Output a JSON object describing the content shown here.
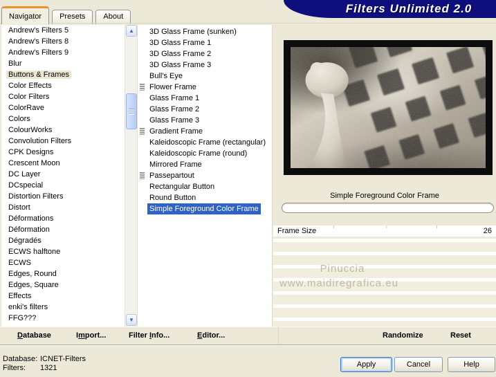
{
  "banner": {
    "title": "Filters Unlimited 2.0"
  },
  "icons": {
    "scroll_up_icon": "▲",
    "scroll_down_icon": "▼"
  },
  "tabs": [
    {
      "label": "Navigator",
      "active": true
    },
    {
      "label": "Presets"
    },
    {
      "label": "About"
    }
  ],
  "categories": [
    {
      "label": "Andrew's Filters 5"
    },
    {
      "label": "Andrew's Filters 8"
    },
    {
      "label": "Andrew's Filters 9"
    },
    {
      "label": "Blur"
    },
    {
      "label": "Buttons & Frames",
      "highlight": true
    },
    {
      "label": "Color Effects"
    },
    {
      "label": "Color Filters"
    },
    {
      "label": "ColorRave"
    },
    {
      "label": "Colors"
    },
    {
      "label": "ColourWorks"
    },
    {
      "label": "Convolution Filters"
    },
    {
      "label": "CPK Designs"
    },
    {
      "label": "Crescent Moon"
    },
    {
      "label": "DC Layer"
    },
    {
      "label": "DCspecial"
    },
    {
      "label": "Distortion Filters"
    },
    {
      "label": "Distort"
    },
    {
      "label": "Déformations"
    },
    {
      "label": "Déformation"
    },
    {
      "label": "Dégradés"
    },
    {
      "label": "ECWS halftone"
    },
    {
      "label": "ECWS"
    },
    {
      "label": "Edges, Round"
    },
    {
      "label": "Edges, Square"
    },
    {
      "label": "Effects"
    },
    {
      "label": "enki's filters"
    },
    {
      "label": "FFG???"
    }
  ],
  "filters": [
    {
      "label": "3D Glass Frame (sunken)"
    },
    {
      "label": "3D Glass Frame 1"
    },
    {
      "label": "3D Glass Frame 2"
    },
    {
      "label": "3D Glass Frame 3"
    },
    {
      "label": "Bull's Eye"
    },
    {
      "label": "Flower Frame",
      "marked": true
    },
    {
      "label": "Glass Frame 1"
    },
    {
      "label": "Glass Frame 2"
    },
    {
      "label": "Glass Frame 3"
    },
    {
      "label": "Gradient Frame",
      "marked": true
    },
    {
      "label": "Kaleidoscopic Frame (rectangular)"
    },
    {
      "label": "Kaleidoscopic Frame (round)"
    },
    {
      "label": "Mirrored Frame"
    },
    {
      "label": "Passepartout",
      "marked": true
    },
    {
      "label": "Rectangular Button"
    },
    {
      "label": "Round Button"
    },
    {
      "label": "Simple Foreground Color Frame",
      "selected": true
    }
  ],
  "controls": {
    "selected_filter_label": "Simple Foreground Color Frame",
    "frame_size": {
      "name": "Frame Size",
      "value": "26"
    }
  },
  "watermark": {
    "line1": "Pinuccia",
    "line2": "www.maidiregrafica.eu"
  },
  "menu": {
    "database": {
      "label": "Database",
      "accel": 0
    },
    "import": {
      "label": "Import...",
      "accel": 1
    },
    "filter_info": {
      "label": "Filter Info...",
      "accel": 7
    },
    "editor": {
      "label": "Editor...",
      "accel": 0
    },
    "randomize": {
      "label": "Randomize",
      "accel": -1
    },
    "reset": {
      "label": "Reset",
      "accel": -1
    }
  },
  "status": {
    "database_label": "Database:",
    "database_value": "ICNET-Filters",
    "filters_label": "Filters:",
    "filters_value": "1321"
  },
  "footer": {
    "apply": "Apply",
    "cancel": "Cancel",
    "help": "Help"
  },
  "colors": {
    "banner": "#0e0e7d",
    "selection": "#2f62c4",
    "dialog_bg": "#ece9d8",
    "tab_accent": "#e5932f"
  }
}
